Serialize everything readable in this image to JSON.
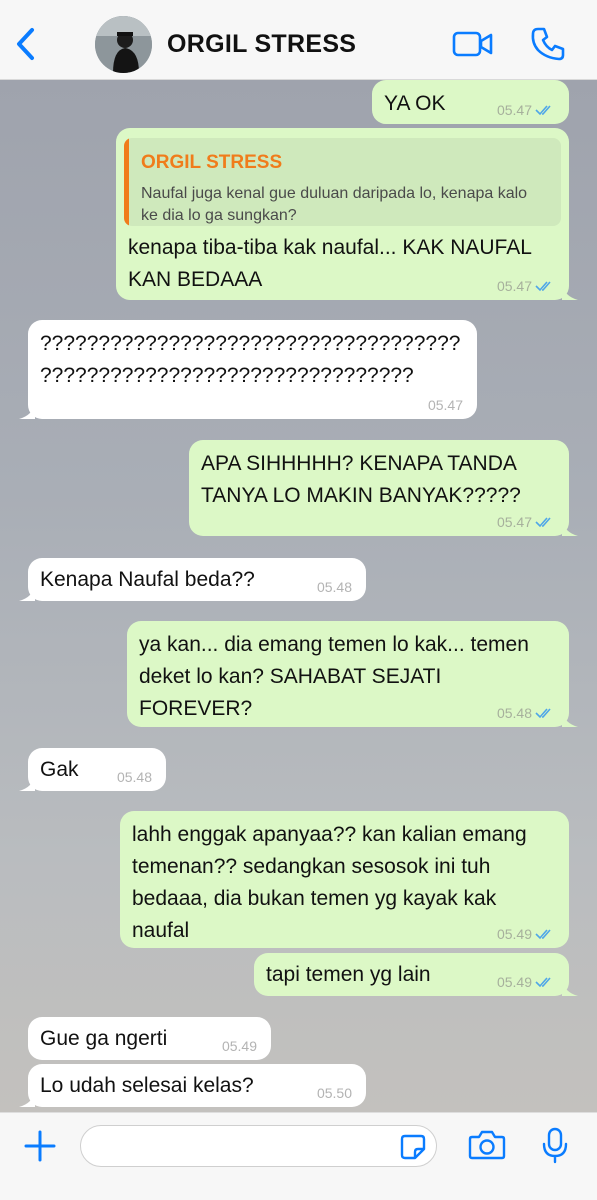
{
  "header": {
    "contact_name": "ORGIL STRESS",
    "icons": [
      "back-chevron-icon",
      "video-call-icon",
      "phone-call-icon"
    ]
  },
  "colors": {
    "accent": "#0a7cff",
    "outgoing_bubble": "#dcf8c6",
    "incoming_bubble": "#ffffff",
    "quote_name": "#f07c1b",
    "read_ticks": "#4fa6e8"
  },
  "messages": [
    {
      "direction": "out",
      "text": "YA OK",
      "time": "05.47",
      "read": true
    },
    {
      "direction": "out",
      "quote": {
        "name": "ORGIL STRESS",
        "text": "Naufal juga kenal gue duluan daripada lo, kenapa kalo ke dia lo ga sungkan?"
      },
      "text": "kenapa tiba-tiba kak naufal... KAK NAUFAL KAN BEDAAA",
      "time": "05.47",
      "read": true
    },
    {
      "direction": "in",
      "text": "????????????????????????????????????\n????????????????????????????????",
      "time": "05.47"
    },
    {
      "direction": "out",
      "text": "APA SIHHHHH? KENAPA TANDA TANYA LO MAKIN BANYAK?????",
      "time": "05.47",
      "read": true
    },
    {
      "direction": "in",
      "text": "Kenapa Naufal beda??",
      "time": "05.48"
    },
    {
      "direction": "out",
      "text": "ya kan... dia emang temen lo kak... temen deket lo kan? SAHABAT SEJATI FOREVER?",
      "time": "05.48",
      "read": true
    },
    {
      "direction": "in",
      "text": "Gak",
      "time": "05.48"
    },
    {
      "direction": "out",
      "text": "lahh enggak apanyaa?? kan kalian emang temenan?? sedangkan sesosok ini tuh bedaaa, dia bukan temen yg kayak kak naufal",
      "time": "05.49",
      "read": true
    },
    {
      "direction": "out",
      "text": "tapi temen yg lain",
      "time": "05.49",
      "read": true
    },
    {
      "direction": "in",
      "text": "Gue ga ngerti",
      "time": "05.49"
    },
    {
      "direction": "in",
      "text": "Lo udah selesai kelas?",
      "time": "05.50"
    }
  ],
  "composer": {
    "placeholder": "",
    "icons": [
      "plus-icon",
      "sticker-icon",
      "camera-icon",
      "microphone-icon"
    ]
  }
}
